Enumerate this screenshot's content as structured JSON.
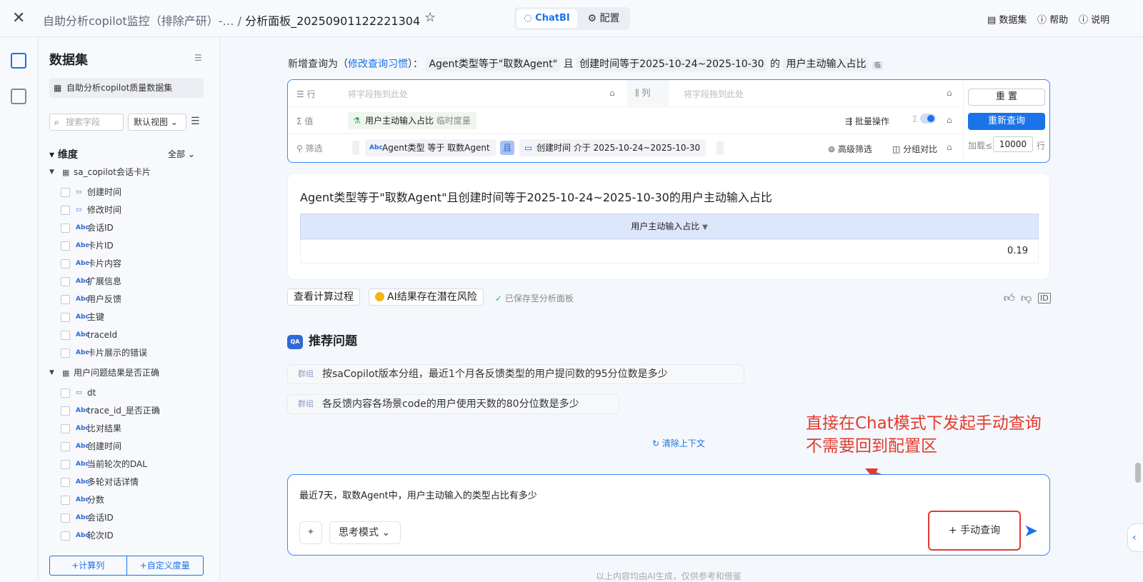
{
  "header": {
    "close_icon": "close-icon",
    "breadcrumb_prefix": "自助分析copilot监控（排除产研）-…",
    "breadcrumb_sep": "/",
    "breadcrumb_current": "分析面板_20250901122221304",
    "star_icon": "star-icon",
    "tab_chatbi": "ChatBI",
    "tab_config": "配置",
    "link_dataset": "数据集",
    "link_help": "帮助",
    "link_doc": "说明"
  },
  "sidebar": {
    "title": "数据集",
    "dataset": "自助分析copilot质量数据集",
    "search_placeholder": "搜索字段",
    "view": "默认视图",
    "dimension_header": "维度",
    "dimension_filter": "全部",
    "tables": [
      {
        "name": "sa_copilot会话卡片",
        "fields": [
          {
            "t": "date",
            "n": "创建时间"
          },
          {
            "t": "date",
            "n": "修改时间"
          },
          {
            "t": "Abc",
            "n": "会话ID"
          },
          {
            "t": "Abc",
            "n": "卡片ID"
          },
          {
            "t": "Abc",
            "n": "卡片内容"
          },
          {
            "t": "Abc",
            "n": "扩展信息"
          },
          {
            "t": "Abc",
            "n": "用户反馈"
          },
          {
            "t": "Abc",
            "n": "主键"
          },
          {
            "t": "Abc",
            "n": "traceId"
          },
          {
            "t": "Abc",
            "n": "卡片展示的错误"
          }
        ]
      },
      {
        "name": "用户问题结果是否正确",
        "fields": [
          {
            "t": "date",
            "n": "dt"
          },
          {
            "t": "Abc",
            "n": "trace_id_是否正确"
          },
          {
            "t": "Abc",
            "n": "比对结果"
          },
          {
            "t": "Abc",
            "n": "创建时间"
          },
          {
            "t": "Abc",
            "n": "当前轮次的DAL"
          },
          {
            "t": "Abc",
            "n": "多轮对话详情"
          },
          {
            "t": "Abc",
            "n": "分数"
          },
          {
            "t": "Abc",
            "n": "会话ID"
          },
          {
            "t": "Abc",
            "n": "轮次ID"
          }
        ]
      }
    ],
    "btn_calc": "+计算列",
    "btn_measure": "+自定义度量"
  },
  "query": {
    "intro_prefix": "新增查询为（",
    "intro_link": "修改查询习惯",
    "intro_suffix": "）：",
    "cond1": "Agent类型等于\"取数Agent\"",
    "and": "且",
    "cond2": "创建时间等于2025-10-24~2025-10-30",
    "of": "的",
    "measure": "用户主动输入占比",
    "temp_tag": "临"
  },
  "builder": {
    "row_label": "☰ 行",
    "row_placeholder": "将字段拖到此处",
    "col_label": "⫼ 列",
    "col_placeholder": "将字段拖到此处",
    "value_label": "Σ 值",
    "value_chip": "用户主动输入占比",
    "value_chip_sub": "临时度量",
    "batch": "批量操作",
    "filter_label": "筛选",
    "filter1": "Agent类型 等于 取数Agent",
    "filter_and": "且",
    "filter2": "创建时间 介于 2025-10-24~2025-10-30",
    "adv_filter": "高级筛选",
    "group_compare": "分组对比",
    "reset": "重 置",
    "requery": "重新查询",
    "limit_label": "加载≤",
    "limit_value": "10000",
    "limit_unit": "行"
  },
  "result": {
    "title": "Agent类型等于\"取数Agent\"且创建时间等于2025-10-24~2025-10-30的用户主动输入占比",
    "column": "用户主动输入占比",
    "value": "0.19"
  },
  "actions": {
    "calc_process": "查看计算过程",
    "risk": "AI结果存在潜在风险",
    "saved": "已保存至分析面板"
  },
  "recommend": {
    "badge": "QA",
    "title": "推荐问题",
    "items": [
      {
        "tag": "群组",
        "text": "按saCopilot版本分组，最近1个月各反馈类型的用户提问数的95分位数是多少"
      },
      {
        "tag": "群组",
        "text": "各反馈内容各场景code的用户使用天数的80分位数是多少"
      }
    ],
    "clear": "清除上下文"
  },
  "annotation": {
    "line1": "直接在Chat模式下发起手动查询",
    "line2": "不需要回到配置区"
  },
  "input": {
    "text": "最近7天，取数Agent中，用户主动输入的类型占比有多少",
    "think_mode": "思考模式",
    "manual_query": "手动查询"
  },
  "footer": {
    "note": "以上内容均由AI生成，仅供参考和借鉴"
  },
  "colors": {
    "accent": "#1a73e8",
    "annotation": "#e23b2e"
  }
}
